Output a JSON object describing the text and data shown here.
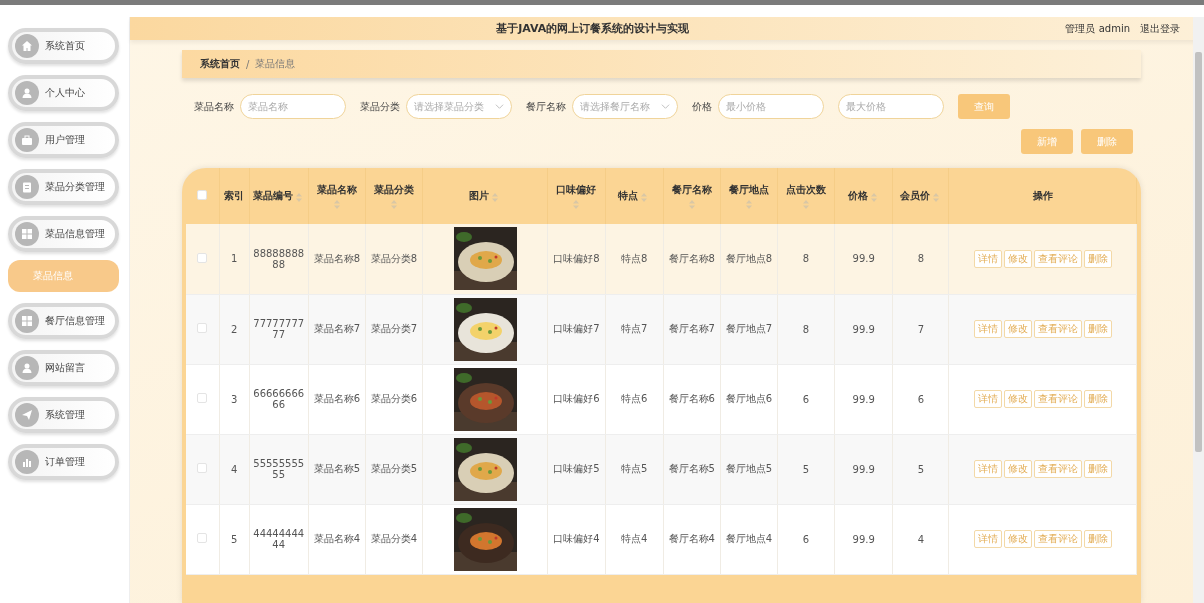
{
  "header": {
    "title": "基于JAVA的网上订餐系统的设计与实现",
    "user": "管理员 admin",
    "logout": "退出登录"
  },
  "sidebar": {
    "items": [
      {
        "label": "系统首页"
      },
      {
        "label": "个人中心"
      },
      {
        "label": "用户管理"
      },
      {
        "label": "菜品分类管理"
      },
      {
        "label": "菜品信息管理",
        "children": [
          {
            "label": "菜品信息",
            "selected": true
          }
        ]
      },
      {
        "label": "餐厅信息管理"
      },
      {
        "label": "网站留言"
      },
      {
        "label": "系统管理"
      },
      {
        "label": "订单管理"
      }
    ]
  },
  "breadcrumb": [
    "系统首页",
    "/",
    "菜品信息"
  ],
  "filters": [
    {
      "kind": "input",
      "label": "菜品名称",
      "placeholder": "菜品名称"
    },
    {
      "kind": "select",
      "label": "菜品分类",
      "placeholder": "请选择菜品分类"
    },
    {
      "kind": "select",
      "label": "餐厅名称",
      "placeholder": "请选择餐厅名称"
    },
    {
      "kind": "input",
      "label": "价格",
      "placeholder": "最小价格"
    },
    {
      "kind": "input",
      "placeholder": "最大价格"
    }
  ],
  "search_button": "查询",
  "toolbar_buttons": [
    "新增",
    "删除"
  ],
  "table": {
    "all_checked": false,
    "columns": [
      {
        "kind": "text",
        "label": "索引",
        "sortable": false
      },
      {
        "kind": "text",
        "label": "菜品编号",
        "sortable": true
      },
      {
        "kind": "text",
        "label": "菜品名称",
        "sortable": true
      },
      {
        "kind": "text",
        "label": "菜品分类",
        "sortable": true
      },
      {
        "kind": "picture",
        "label": "图片",
        "sortable": true
      },
      {
        "kind": "text",
        "label": "口味偏好",
        "sortable": true
      },
      {
        "kind": "text",
        "label": "特点",
        "sortable": true
      },
      {
        "kind": "text",
        "label": "餐厅名称",
        "sortable": true
      },
      {
        "kind": "text",
        "label": "餐厅地点",
        "sortable": true
      },
      {
        "kind": "text",
        "label": "点击次数",
        "sortable": true
      },
      {
        "kind": "text",
        "label": "价格",
        "sortable": true
      },
      {
        "kind": "text",
        "label": "会员价",
        "sortable": true
      },
      {
        "kind": "actions",
        "label": "操作",
        "sortable": false
      }
    ],
    "rows": [
      {
        "highlighted": true,
        "checked": false,
        "cells": [
          "1",
          "8888888888",
          "菜品名称8",
          "菜品分类8",
          {
            "kind": "picture"
          },
          "口味偏好8",
          "特点8",
          "餐厅名称8",
          "餐厅地点8",
          "8",
          "99.9",
          "8",
          [
            "详情",
            "修改",
            "查看评论",
            "删除"
          ]
        ]
      },
      {
        "highlighted": false,
        "checked": false,
        "cells": [
          "2",
          "7777777777",
          "菜品名称7",
          "菜品分类7",
          {
            "kind": "picture"
          },
          "口味偏好7",
          "特点7",
          "餐厅名称7",
          "餐厅地点7",
          "8",
          "99.9",
          "7",
          [
            "详情",
            "修改",
            "查看评论",
            "删除"
          ]
        ]
      },
      {
        "highlighted": false,
        "checked": false,
        "cells": [
          "3",
          "6666666666",
          "菜品名称6",
          "菜品分类6",
          {
            "kind": "picture"
          },
          "口味偏好6",
          "特点6",
          "餐厅名称6",
          "餐厅地点6",
          "6",
          "99.9",
          "6",
          [
            "详情",
            "修改",
            "查看评论",
            "删除"
          ]
        ]
      },
      {
        "highlighted": false,
        "checked": false,
        "cells": [
          "4",
          "5555555555",
          "菜品名称5",
          "菜品分类5",
          {
            "kind": "picture"
          },
          "口味偏好5",
          "特点5",
          "餐厅名称5",
          "餐厅地点5",
          "5",
          "99.9",
          "5",
          [
            "详情",
            "修改",
            "查看评论",
            "删除"
          ]
        ]
      },
      {
        "highlighted": false,
        "checked": false,
        "cells": [
          "5",
          "4444444444",
          "菜品名称4",
          "菜品分类4",
          {
            "kind": "picture"
          },
          "口味偏好4",
          "特点4",
          "餐厅名称4",
          "餐厅地点4",
          "6",
          "99.9",
          "4",
          [
            "详情",
            "修改",
            "查看评论",
            "删除"
          ]
        ]
      }
    ]
  }
}
